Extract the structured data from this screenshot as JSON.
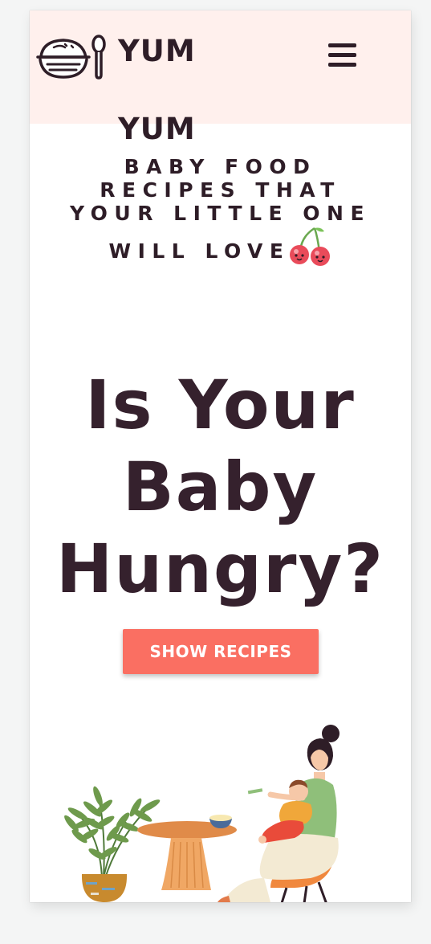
{
  "header": {
    "brand_line1": "YUM",
    "brand_line2": "YUM",
    "logo_icon": "bowl-and-spoon-icon",
    "menu_icon": "hamburger-menu-icon",
    "background_color": "#fff0ed"
  },
  "tagline": {
    "line1": "BABY FOOD",
    "line2": "RECIPES THAT",
    "line3": "YOUR LITTLE ONE",
    "line4": "WILL LOVE",
    "emoji_icon": "cherries-icon"
  },
  "hero": {
    "title_line1": "Is Your",
    "title_line2": "Baby",
    "title_line3": "Hungry?",
    "cta_label": "SHOW RECIPES",
    "cta_color": "#fa6f62"
  },
  "illustration": {
    "description_icon": "mother-feeding-baby-illustration"
  },
  "colors": {
    "text_dark": "#2e1d27",
    "page_background": "#f4f5f5"
  }
}
